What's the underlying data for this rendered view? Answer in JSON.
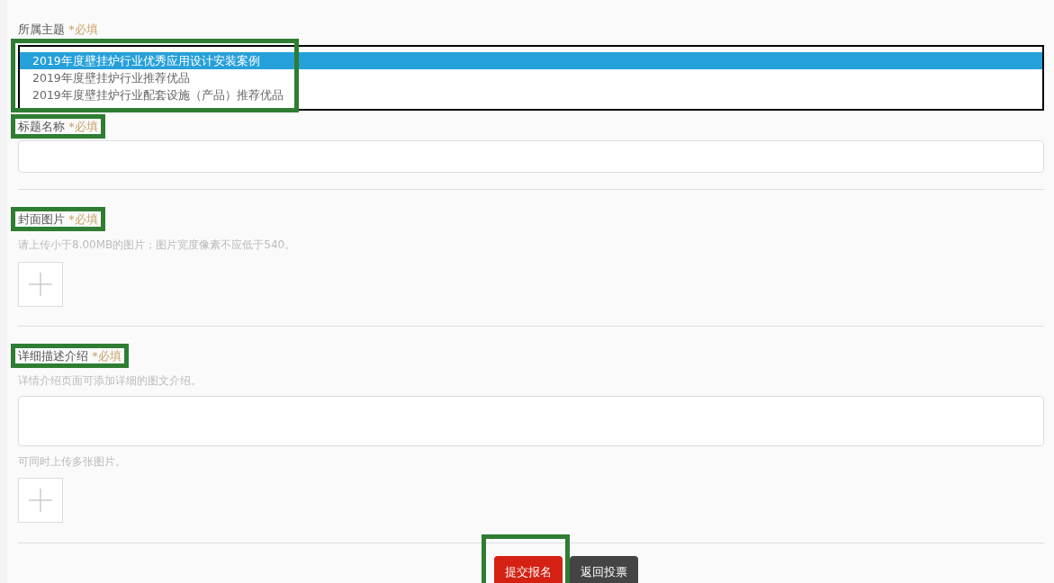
{
  "topic": {
    "label": "所属主题",
    "required": "*必填",
    "highlighted": true,
    "options": [
      {
        "text": "2019年度壁挂炉行业优秀应用设计安装案例",
        "selected": true
      },
      {
        "text": "2019年度壁挂炉行业推荐优品",
        "selected": false
      },
      {
        "text": "2019年度壁挂炉行业配套设施（产品）推荐优品",
        "selected": false
      }
    ]
  },
  "title_field": {
    "label": "标题名称",
    "required": "*必填",
    "label_highlighted": true
  },
  "cover": {
    "label": "封面图片",
    "required": "*必填",
    "label_highlighted": true,
    "hint": "请上传小于8.00MB的图片；图片宽度像素不应低于540。"
  },
  "description": {
    "label": "详细描述介绍",
    "required": "*必填",
    "label_highlighted": true,
    "hint": "详情介绍页面可添加详细的图文介绍。",
    "upload_hint": "可同时上传多张图片。"
  },
  "buttons": [
    {
      "kind": "primary",
      "label": "提交报名",
      "highlighted": true
    },
    {
      "kind": "secondary",
      "label": "返回投票",
      "highlighted": false
    }
  ]
}
